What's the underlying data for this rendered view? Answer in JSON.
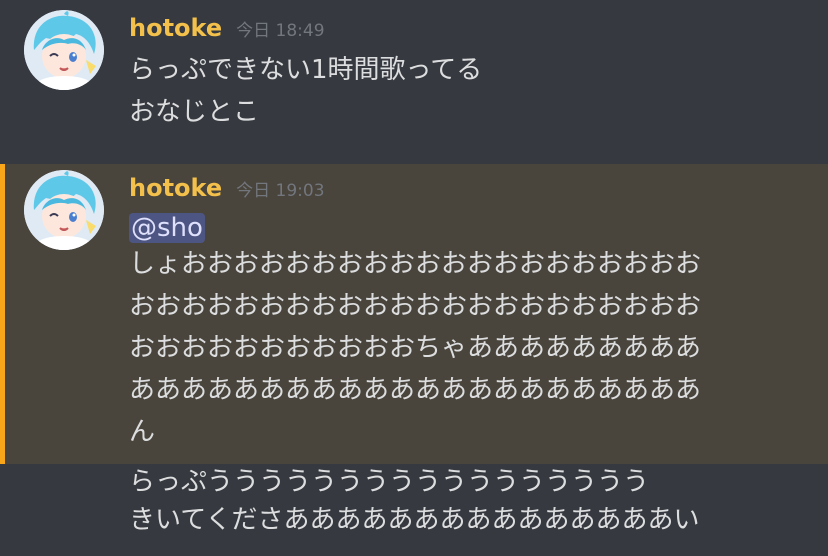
{
  "messages": [
    {
      "username": "hotoke",
      "timestamp": "今日 18:49",
      "lines": [
        "らっぷできない1時間歌ってる",
        "おなじとこ"
      ]
    },
    {
      "username": "hotoke",
      "timestamp": "今日 19:03",
      "mention": "@sho",
      "lines": [
        "しょおおおおおおおおおおおおおおおおおおおお",
        "おおおおおおおおおおおおおおおおおおおおおお",
        "おおおおおおおおおおおちゃあああああああああ",
        "ああああああああああああああああああああああ",
        "ん"
      ]
    },
    {
      "lines": [
        "らっぷううううううううううううううううう",
        "きいてくださあああああああああああああああい"
      ]
    }
  ],
  "colors": {
    "background": "#36393f",
    "mention_highlight_background": "#49443c",
    "mention_bar": "#faa61a",
    "username": "#f3c04b",
    "timestamp": "#72767d",
    "text": "#dcddde",
    "mention_pill": "#4d5582"
  },
  "icons": {
    "avatar": "anime-avatar-icon"
  }
}
